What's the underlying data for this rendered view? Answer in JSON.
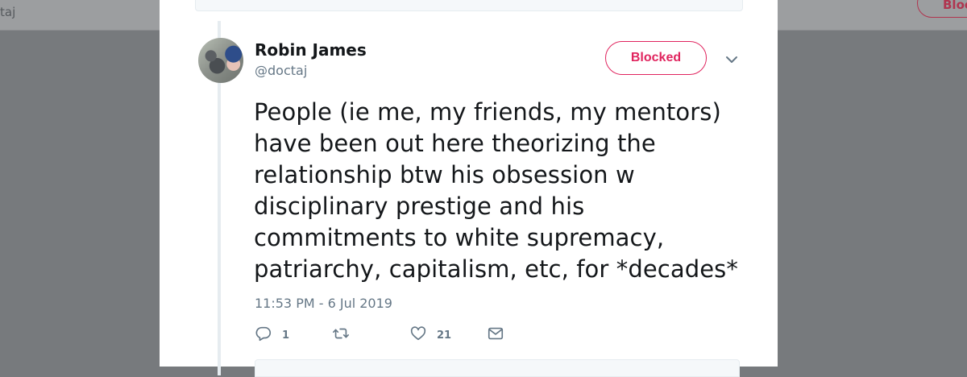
{
  "background_page": {
    "handle_fragment": "taj",
    "blocked_label_fragment": "Bloc"
  },
  "tweet": {
    "author_name": "Robin James",
    "author_handle": "@doctaj",
    "blocked_label": "Blocked",
    "text_lines": [
      "People (ie me, my friends, my mentors)",
      "have been out here theorizing the",
      "relationship btw his obsession w",
      "disciplinary prestige and his",
      "commitments to white supremacy,",
      "patriarchy, capitalism, etc, for *decades*"
    ],
    "timestamp": "11:53 PM - 6 Jul 2019",
    "actions": {
      "reply_count": "1",
      "retweet_count": "",
      "like_count": "21"
    },
    "icons": {
      "reply": "reply-icon",
      "retweet": "retweet-icon",
      "like": "heart-icon",
      "message": "envelope-icon",
      "menu": "chevron-down-icon"
    }
  },
  "colors": {
    "blocked_accent": "#e0245e",
    "secondary_text": "#657786",
    "primary_text": "#14171a",
    "overlay": "#777a7d"
  }
}
